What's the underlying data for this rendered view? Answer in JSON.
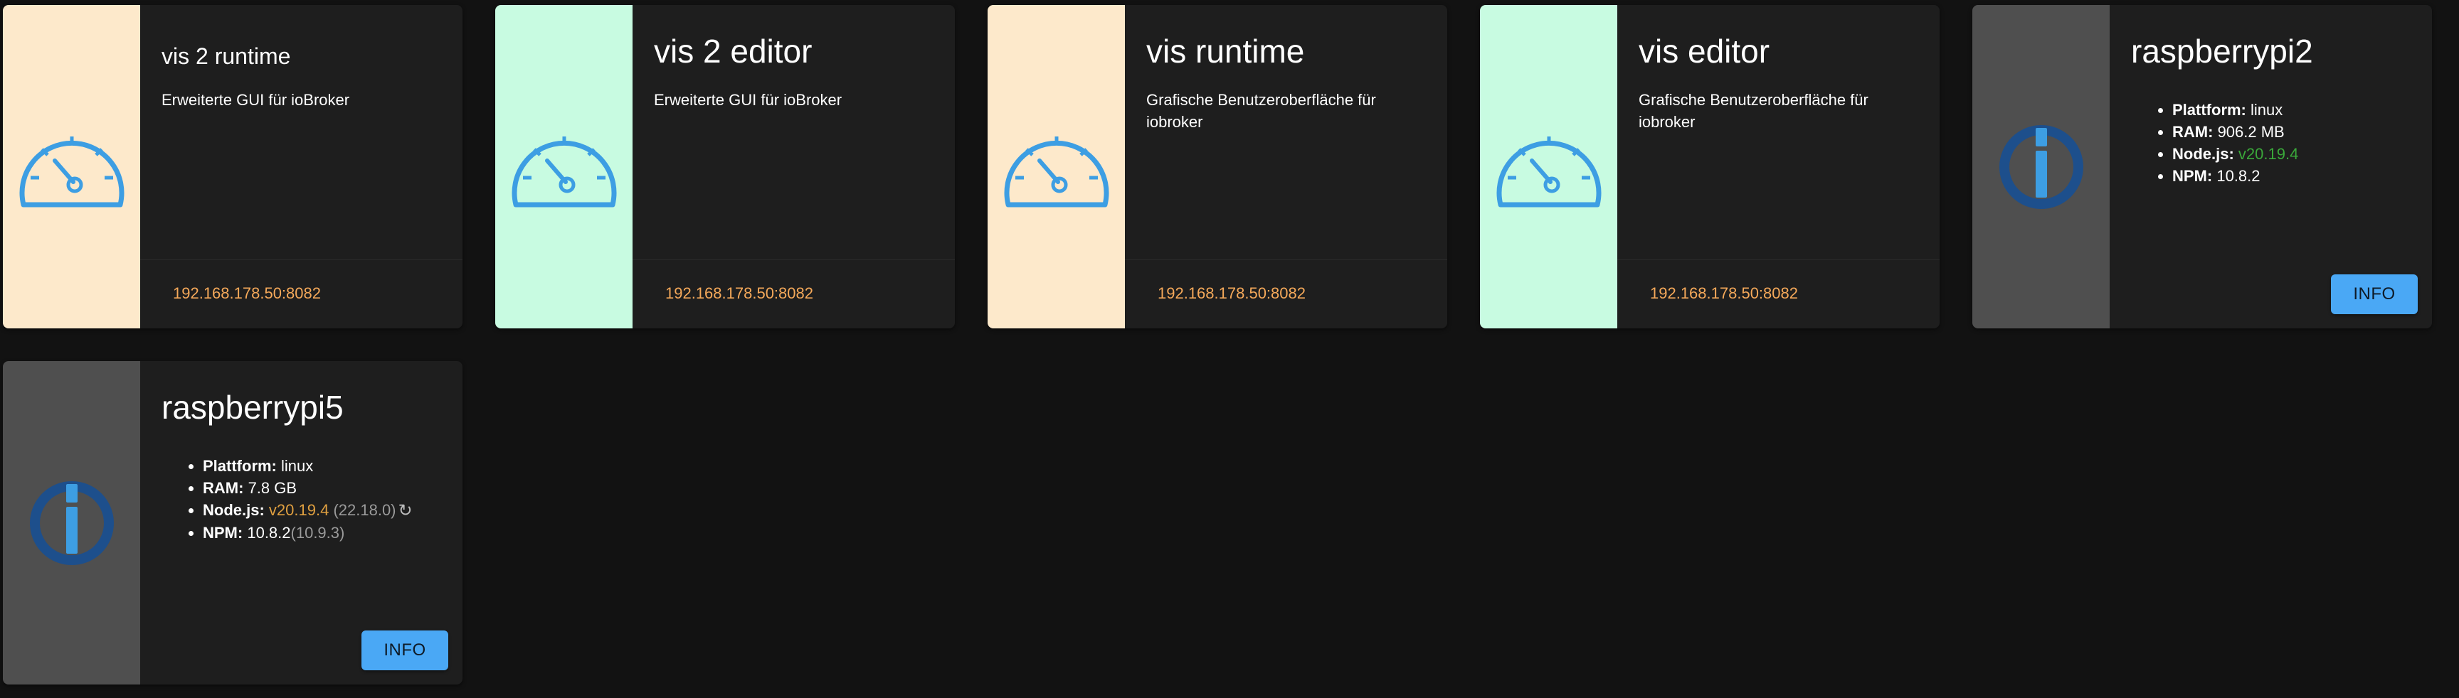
{
  "colors": {
    "peach": "#fde9cb",
    "mint": "#c8fbe1",
    "host_bg": "#4f4f4f",
    "url": "#f5a95a",
    "button": "#4aa8f5",
    "node_green": "#3aa83a",
    "node_orange": "#e0a040"
  },
  "cards": [
    {
      "title": "vis 2 runtime",
      "description": "Erweiterte GUI für ioBroker",
      "url": "192.168.178.50:8082",
      "icon": "speedometer-icon"
    },
    {
      "title": "vis 2 editor",
      "description": "Erweiterte GUI für ioBroker",
      "url": "192.168.178.50:8082",
      "icon": "speedometer-icon"
    },
    {
      "title": "vis runtime",
      "description": "Grafische Benutzeroberfläche für iobroker",
      "url": "192.168.178.50:8082",
      "icon": "speedometer-icon"
    },
    {
      "title": "vis editor",
      "description": "Grafische Benutzeroberfläche für iobroker",
      "url": "192.168.178.50:8082",
      "icon": "speedometer-icon"
    }
  ],
  "hosts": [
    {
      "title": "raspberrypi2",
      "icon": "iobroker-logo-icon",
      "platform_label": "Plattform:",
      "platform": "linux",
      "ram_label": "RAM:",
      "ram": "906.2 MB",
      "node_label": "Node.js:",
      "node": "v20.19.4",
      "npm_label": "NPM:",
      "npm": "10.8.2",
      "button": "INFO"
    },
    {
      "title": "raspberrypi5",
      "icon": "iobroker-logo-icon",
      "platform_label": "Plattform:",
      "platform": "linux",
      "ram_label": "RAM:",
      "ram": "7.8 GB",
      "node_label": "Node.js:",
      "node": "v20.19.4",
      "node_available": "(22.18.0)",
      "npm_label": "NPM:",
      "npm": "10.8.2",
      "npm_available": "(10.9.3)",
      "refresh_icon": "refresh-icon",
      "button": "INFO"
    }
  ]
}
